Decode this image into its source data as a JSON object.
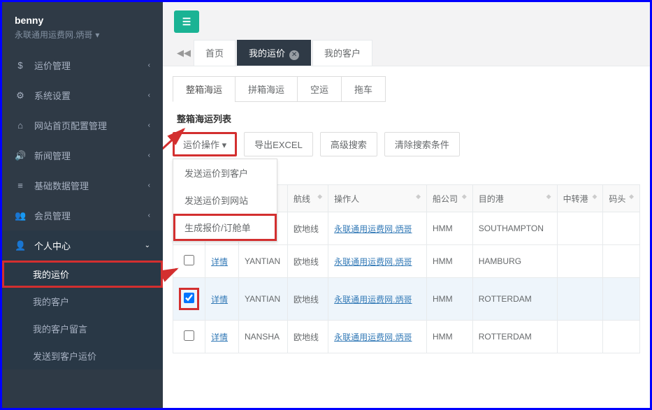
{
  "user": {
    "name": "benny",
    "sub": "永联通用运费网.炳哥"
  },
  "sidebar": {
    "items": [
      {
        "icon": "currency-icon",
        "glyph": "$",
        "label": "运价管理"
      },
      {
        "icon": "gear-icon",
        "glyph": "⚙",
        "label": "系统设置"
      },
      {
        "icon": "home-config-icon",
        "glyph": "⌂",
        "label": "网站首页配置管理"
      },
      {
        "icon": "speaker-icon",
        "glyph": "🔊",
        "label": "新闻管理"
      },
      {
        "icon": "database-icon",
        "glyph": "≡",
        "label": "基础数据管理"
      },
      {
        "icon": "users-icon",
        "glyph": "👥",
        "label": "会员管理"
      },
      {
        "icon": "user-icon",
        "glyph": "👤",
        "label": "个人中心",
        "expanded": true,
        "sub": [
          {
            "label": "我的运价",
            "active": true
          },
          {
            "label": "我的客户"
          },
          {
            "label": "我的客户留言"
          },
          {
            "label": "发送到客户运价"
          }
        ]
      }
    ]
  },
  "tabs": {
    "back_glyph": "◀◀",
    "items": [
      {
        "label": "首页",
        "active": false
      },
      {
        "label": "我的运价",
        "active": true,
        "closable": true
      },
      {
        "label": "我的客户",
        "active": false
      }
    ]
  },
  "hamburger_glyph": "☰",
  "type_tabs": [
    "整箱海运",
    "拼箱海运",
    "空运",
    "拖车"
  ],
  "panel_title": "整箱海运列表",
  "toolbar": {
    "rate_op": "运价操作",
    "export": "导出EXCEL",
    "adv_search": "高级搜索",
    "clear": "清除搜索条件"
  },
  "dropdown": {
    "items": [
      "发送运价到客户",
      "发送运价到网站",
      "生成报价/订舱单"
    ]
  },
  "table": {
    "headers": [
      "",
      "",
      "",
      "航线",
      "操作人",
      "船公司",
      "目的港",
      "中转港",
      "码头"
    ],
    "detail_label": "详情",
    "rows": [
      {
        "checked": false,
        "port": "",
        "route": "欧地线",
        "operator": "永联通用运费网.炳哥",
        "carrier": "HMM",
        "dest": "SOUTHAMPTON",
        "transit": "",
        "terminal": ""
      },
      {
        "checked": false,
        "port": "YANTIAN",
        "route": "欧地线",
        "operator": "永联通用运费网.炳哥",
        "carrier": "HMM",
        "dest": "HAMBURG",
        "transit": "",
        "terminal": ""
      },
      {
        "checked": true,
        "port": "YANTIAN",
        "route": "欧地线",
        "operator": "永联通用运费网.炳哥",
        "carrier": "HMM",
        "dest": "ROTTERDAM",
        "transit": "",
        "terminal": "",
        "selected": true
      },
      {
        "checked": false,
        "port": "NANSHA",
        "route": "欧地线",
        "operator": "永联通用运费网.炳哥",
        "carrier": "HMM",
        "dest": "ROTTERDAM",
        "transit": "",
        "terminal": ""
      }
    ]
  }
}
